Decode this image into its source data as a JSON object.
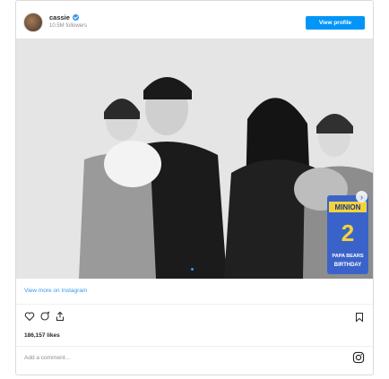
{
  "header": {
    "username": "cassie",
    "followers": "10.5M followers",
    "view_profile": "View profile"
  },
  "photo": {
    "description_icon": "photo-image",
    "sign_text_1": "MINION",
    "sign_text_2": "PAPA BEARS",
    "sign_text_3": "BIRTHDAY",
    "sign_number": "2"
  },
  "links": {
    "view_more": "View more on Instagram"
  },
  "footer": {
    "likes": "186,157 likes",
    "comment_placeholder": "Add a comment..."
  },
  "icons": {
    "heart": "heart-icon",
    "comment": "comment-icon",
    "share": "share-icon",
    "bookmark": "bookmark-icon",
    "instagram": "instagram-icon"
  },
  "colors": {
    "accent": "#0095f6",
    "link": "#3897f0"
  }
}
